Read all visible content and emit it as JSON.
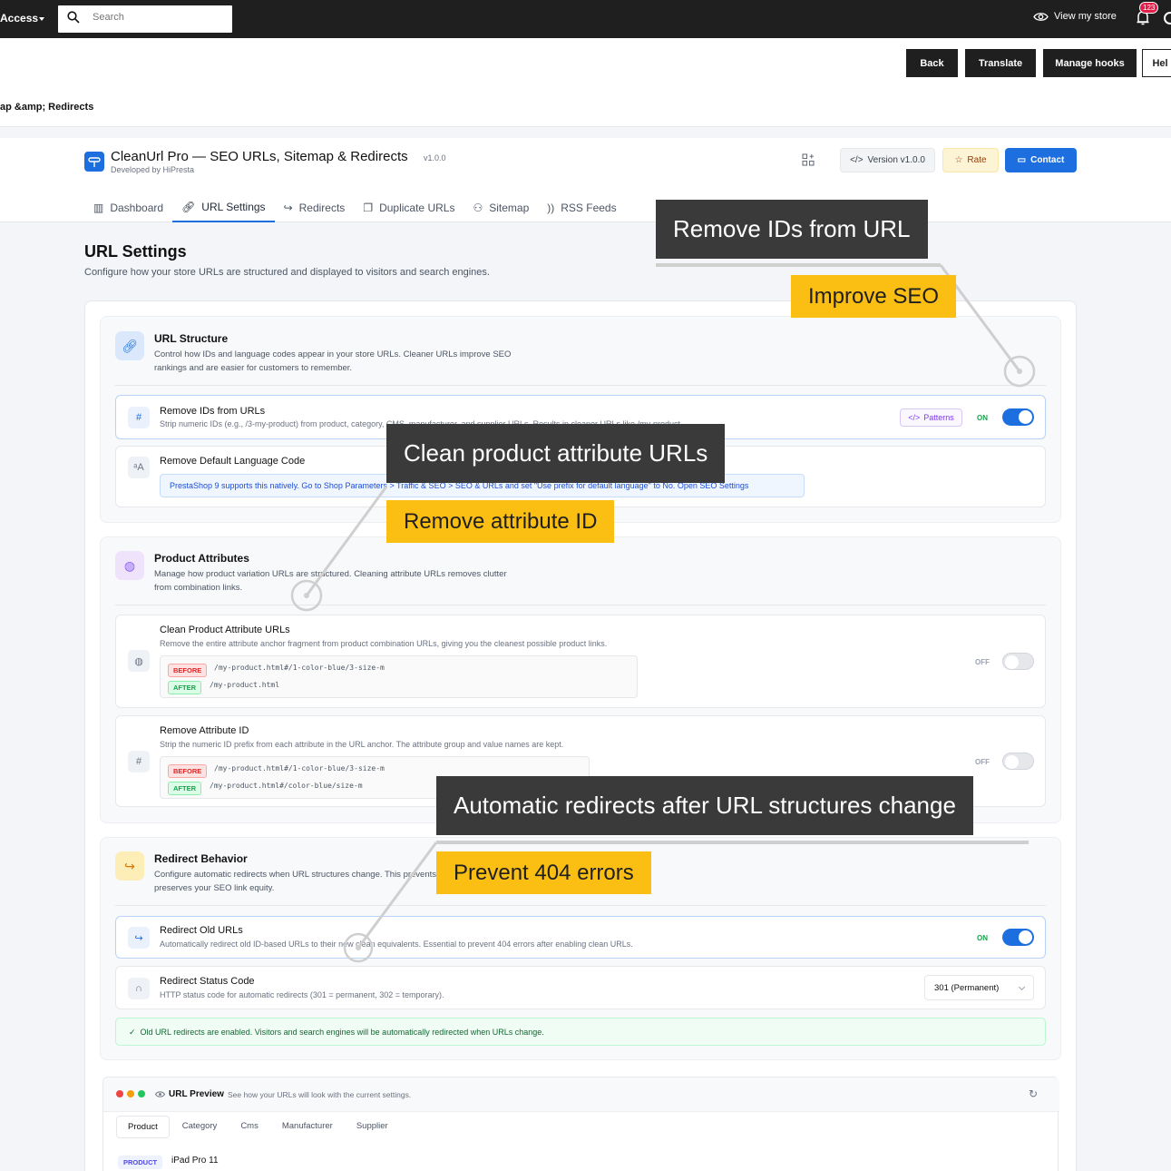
{
  "topbar": {
    "access_label": "Access",
    "search_placeholder": "Search",
    "view_store": "View my store",
    "notification_count": "123"
  },
  "toolbar": {
    "buttons": [
      "Back",
      "Translate",
      "Manage hooks",
      "Hel"
    ],
    "breadcrumb": "ap &amp; Redirects"
  },
  "module": {
    "title": "CleanUrl Pro — SEO URLs, Sitemap & Redirects",
    "version_small": "v1.0.0",
    "developer": "Developed by HiPresta",
    "version_button": "Version v1.0.0",
    "rate_button": "Rate",
    "contact_button": "Contact",
    "tabs": [
      "Dashboard",
      "URL Settings",
      "Redirects",
      "Duplicate URLs",
      "Sitemap",
      "RSS Feeds"
    ]
  },
  "page": {
    "title": "URL Settings",
    "description": "Configure how your store URLs are structured and displayed to visitors and search engines."
  },
  "url_structure": {
    "title": "URL Structure",
    "desc_line1": "Control how IDs and language codes appear in your store URLs. Cleaner URLs improve SEO",
    "desc_line2": "rankings and are easier for customers to remember.",
    "remove_ids": {
      "title": "Remove IDs from URLs",
      "desc": "Strip numeric IDs (e.g., /3-my-product) from product, category, CMS, manufacturer, and supplier URLs. Results in cleaner URLs like /my-product",
      "patterns_label": "Patterns",
      "state": "ON"
    },
    "remove_lang": {
      "title": "Remove Default Language Code",
      "info": "PrestaShop 9 supports this natively. Go to Shop Parameters > Traffic & SEO > SEO & URLs and set \"Use prefix for default language\" to No. Open SEO Settings"
    }
  },
  "product_attributes": {
    "title": "Product Attributes",
    "desc_line1": "Manage how product variation URLs are structured. Cleaning attribute URLs removes clutter",
    "desc_line2": "from combination links.",
    "clean": {
      "title": "Clean Product Attribute URLs",
      "desc": "Remove the entire attribute anchor fragment from product combination URLs, giving you the cleanest possible product links.",
      "before_label": "BEFORE",
      "before": "/my-product.html#/1-color-blue/3-size-m",
      "after_label": "AFTER",
      "after": "/my-product.html",
      "state": "OFF"
    },
    "remove_attr": {
      "title": "Remove Attribute ID",
      "desc": "Strip the numeric ID prefix from each attribute in the URL anchor. The attribute group and value names are kept.",
      "before_label": "BEFORE",
      "before": "/my-product.html#/1-color-blue/3-size-m",
      "after_label": "AFTER",
      "after": "/my-product.html#/color-blue/size-m",
      "state": "OFF"
    }
  },
  "redirect_behavior": {
    "title": "Redirect Behavior",
    "desc_line1": "Configure automatic redirects when URL structures change. This prevents broken links and",
    "desc_line2": "preserves your SEO link equity.",
    "redirect_old": {
      "title": "Redirect Old URLs",
      "desc": "Automatically redirect old ID-based URLs to their new clean equivalents. Essential to prevent 404 errors after enabling clean URLs.",
      "state": "ON"
    },
    "status_code": {
      "title": "Redirect Status Code",
      "desc": "HTTP status code for automatic redirects (301 = permanent, 302 = temporary).",
      "selected": "301 (Permanent)"
    },
    "success": "Old URL redirects are enabled. Visitors and search engines will be automatically redirected when URLs change."
  },
  "preview": {
    "title": "URL Preview",
    "desc": "See how your URLs will look with the current settings.",
    "tabs": [
      "Product",
      "Category",
      "Cms",
      "Manufacturer",
      "Supplier"
    ],
    "tag": "PRODUCT",
    "item": "iPad Pro 11"
  },
  "callouts": {
    "c1": "Remove IDs from URL",
    "c2": "Improve SEO",
    "c3": "Clean product attribute URLs",
    "c4": "Remove attribute ID",
    "c5": "Automatic redirects after URL structures change",
    "c6": "Prevent 404 errors"
  },
  "colors": {
    "accent": "#1d6fe0",
    "callout_dark": "#3a3a3a",
    "callout_yellow": "#fbbf14"
  }
}
